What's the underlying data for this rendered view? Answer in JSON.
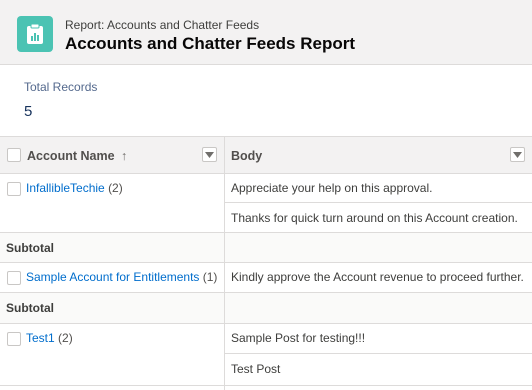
{
  "header": {
    "kicker": "Report: Accounts and Chatter Feeds",
    "title": "Accounts and Chatter Feeds Report",
    "icon": "report-icon",
    "icon_color": "#4bc3b3"
  },
  "summary": {
    "label": "Total Records",
    "value": "5"
  },
  "table": {
    "columns": [
      {
        "label": "Account Name",
        "sort_indicator": "↑"
      },
      {
        "label": "Body"
      }
    ],
    "groups": [
      {
        "account": "InfallibleTechie",
        "count": "(2)",
        "bodies": [
          "Appreciate your help on this approval.",
          "Thanks for quick turn around on this Account creation."
        ]
      },
      {
        "account": "Sample Account for Entitlements",
        "count": "(1)",
        "bodies": [
          "Kindly approve the Account revenue to proceed further."
        ]
      },
      {
        "account": "Test1",
        "count": "(2)",
        "bodies": [
          "Sample Post for testing!!!",
          "Test Post"
        ]
      }
    ],
    "subtotal_label": "Subtotal"
  },
  "colors": {
    "link": "#006dcc",
    "header_bg": "#f3f2f2",
    "border": "#dddbda"
  }
}
